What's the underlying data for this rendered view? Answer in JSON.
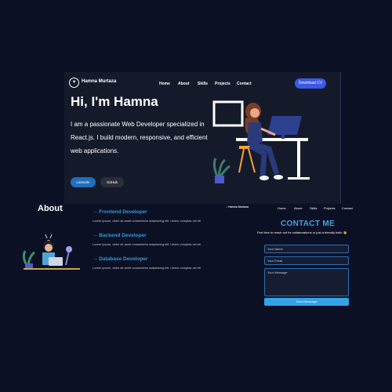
{
  "hero": {
    "brand": "Hamna Murtaza",
    "nav": [
      "Home",
      "About",
      "Skills",
      "Projects",
      "Contact"
    ],
    "download_label": "Download CV",
    "title": "Hi, I'm Hamna",
    "description": "I am a passionate Web Developer specialized in React.js. I build modern, responsive, and efficient web applications.",
    "linkedin_label": "LinkedIn",
    "github_label": "GitHub"
  },
  "about": {
    "heading": "About",
    "skills": [
      {
        "title": "→ Frontend Developer",
        "desc": "Lorem ipsum, dolor sit amet consectetur adipisicing elit. Libero voluptas vel et!"
      },
      {
        "title": "→ Backend Developer",
        "desc": "Lorem ipsum, dolor sit amet consectetur adipisicing elit. Libero voluptas vel et!"
      },
      {
        "title": "→ Database Developer",
        "desc": "Lorem ipsum, dolor sit amet consectetur adipisicing elit. Libero voluptas vel et!"
      }
    ]
  },
  "contact_nav": {
    "logo": "• Hamna Murtaza",
    "links": [
      "Home",
      "About",
      "Skills",
      "Projects",
      "Contact"
    ]
  },
  "contact": {
    "title": "CONTACT ME",
    "subtitle": "Feel free to reach out for collaborations or just a friendly hello 👋",
    "name_placeholder": "Your Name",
    "email_placeholder": "Your Email",
    "message_placeholder": "Your Message",
    "send_label": "Send Message"
  },
  "colors": {
    "background": "#0c1024",
    "hero_panel": "#151a2b",
    "accent_blue": "#3b57e8",
    "skill_title": "#2d9cdb",
    "contact_accent": "#33a3e6"
  }
}
